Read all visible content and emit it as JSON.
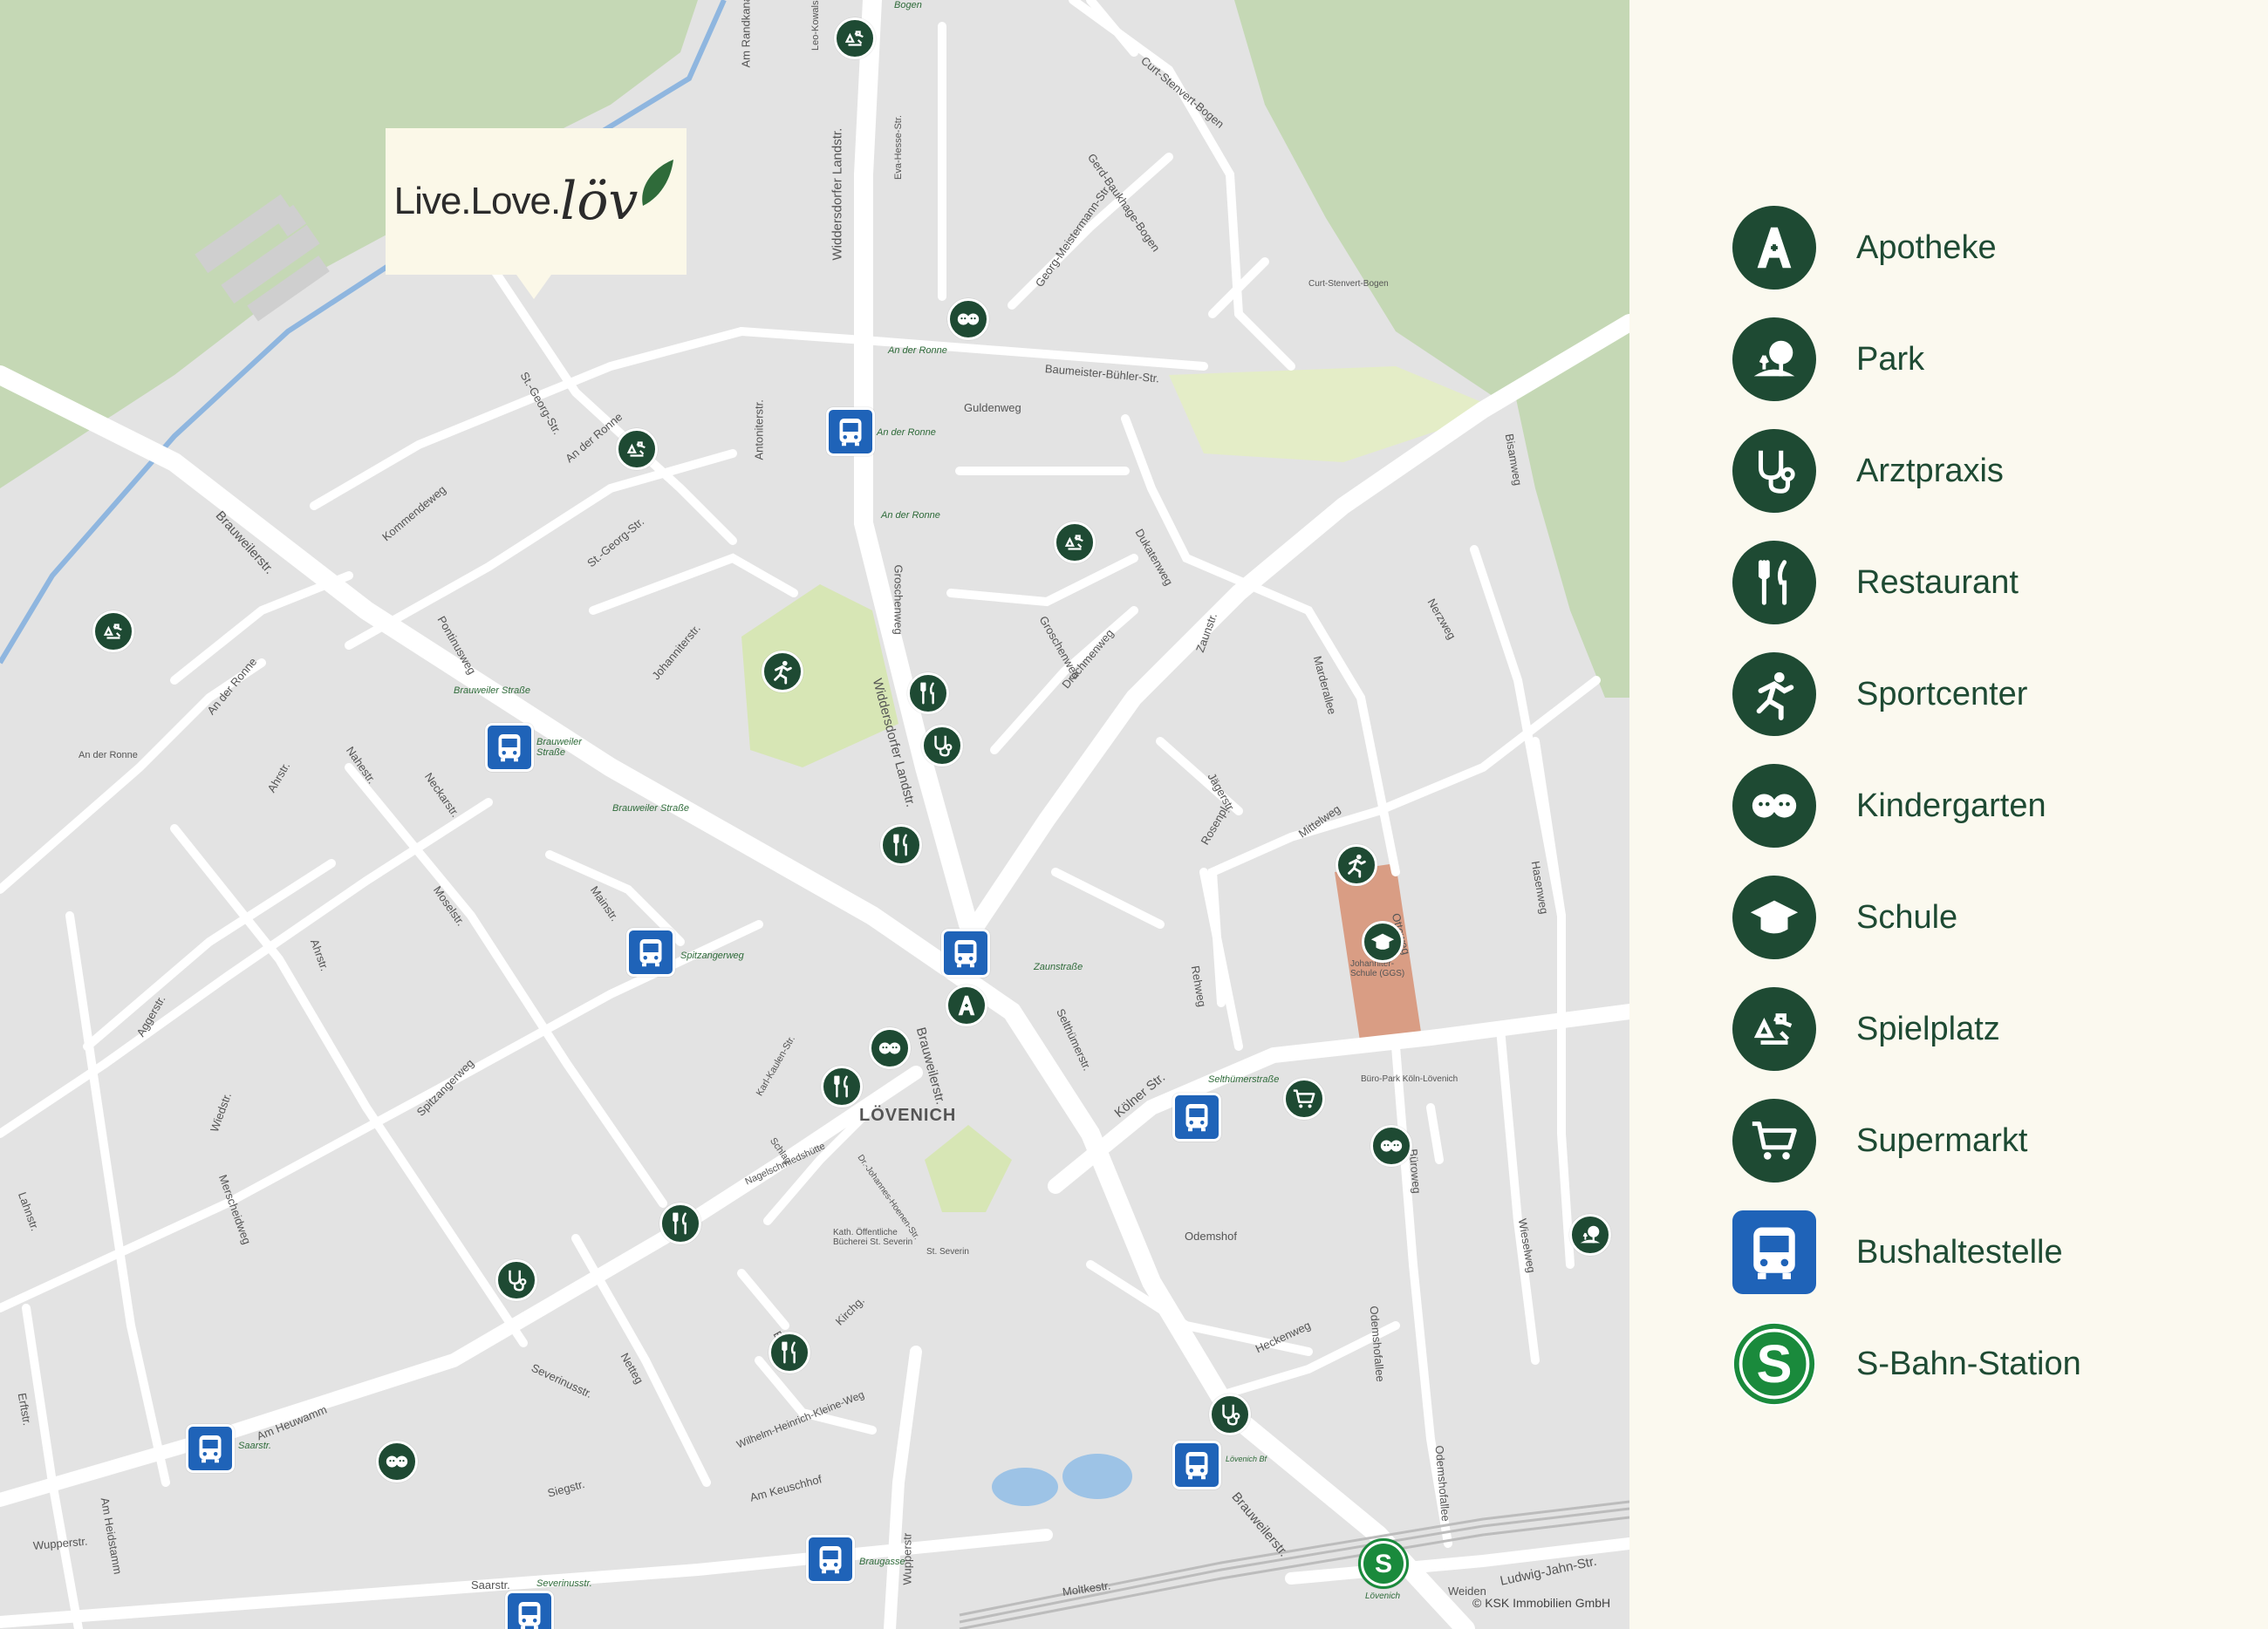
{
  "logo": {
    "text": "Live.Love.",
    "script": "löv"
  },
  "copyright": "© KSK Immobilien GmbH",
  "colors": {
    "marker": "#1e4a33",
    "bus": "#1f63b8",
    "sbahn": "#1a8a3c",
    "park": "#c5d8b5",
    "road": "#ffffff",
    "block": "#e3e3e3",
    "legend_bg": "#fbf9ef"
  },
  "legend": [
    {
      "label": "Apotheke",
      "icon": "pharmacy-icon"
    },
    {
      "label": "Park",
      "icon": "park-icon"
    },
    {
      "label": "Arztpraxis",
      "icon": "stethoscope-icon"
    },
    {
      "label": "Restaurant",
      "icon": "cutlery-icon"
    },
    {
      "label": "Sportcenter",
      "icon": "runner-icon"
    },
    {
      "label": "Kindergarten",
      "icon": "children-icon"
    },
    {
      "label": "Schule",
      "icon": "graduation-cap-icon"
    },
    {
      "label": "Spielplatz",
      "icon": "playground-icon"
    },
    {
      "label": "Supermarkt",
      "icon": "shopping-cart-icon"
    },
    {
      "label": "Bushaltestelle",
      "icon": "bus-icon"
    },
    {
      "label": "S-Bahn-Station",
      "icon": "sbahn-icon"
    }
  ],
  "streets": [
    "Am Randkanal",
    "Leo-Kowalski-Str.",
    "Bogen",
    "Curt-Stenvert-Bogen",
    "Gerd-Baukhage-Bogen",
    "Georg-Meistermann-Str.",
    "Eva-Hesse-Str.",
    "Widdersdorfer Landstr.",
    "Curt-Stenvert-Bogen",
    "Baumeister-Bühler-Str.",
    "Guldenweg",
    "Am Randkanal",
    "St.-Georg-Str.",
    "An der Ronne",
    "Kommendeweg",
    "St.-Georg-Str.",
    "Antoniterstr.",
    "Groschenweg",
    "Groschenweg",
    "Dukatenweg",
    "Drachmenweg",
    "Brauweilerstr.",
    "Pontinusweg",
    "Johanniterstr.",
    "Widdersdorfer Landstr.",
    "Zaunstr.",
    "Bisamweg",
    "Nerzweg",
    "Marderallee",
    "Jägerstr.",
    "Rosenpl.",
    "Mittelweg",
    "Hasenweg",
    "Ottoweg",
    "An der Ronne",
    "An der Ronne",
    "Ahrstr.",
    "Nahestr.",
    "Neckarstr.",
    "Moselstr.",
    "Mainstr.",
    "Ahrstr.",
    "Aggerstr.",
    "Wiedstr.",
    "Merscheidweg",
    "Spitzangerweg",
    "Brauweilerstr.",
    "Karl-Kaulen-Str.",
    "Schlag",
    "Nagelschmiedshütte",
    "Dr.-Johannes-Hoenen-Str.",
    "Kirchg.",
    "Selthümerstr.",
    "Kölner Str.",
    "Rehweg",
    "Büro-Park Köln-Lövenich",
    "Büroweg",
    "Odemshof",
    "Odemshofallee",
    "Wieselweg",
    "Heckenweg",
    "Lahnstr.",
    "Erftstr.",
    "Merscheidweg",
    "Netteg",
    "Severinusstr.",
    "Baug.",
    "Kirchg.",
    "Wilhelm-Heinrich-Kleine-Weg",
    "Am Heuwamm",
    "Siegstr.",
    "Am Keuschhof",
    "Wupperstr.",
    "Am Heidstamm",
    "Saarstr.",
    "Moltkestr.",
    "Brauweilerstr.",
    "Ludwig-Jahn-Str.",
    "Weiden",
    "Odemshofallee",
    "Rosenplatz",
    "Wupperstr"
  ],
  "places": {
    "district": "LÖVENICH",
    "school": "Johanniter-Schule (GGS)",
    "library": "Kath. Öffentliche Bücherei St. Severin",
    "church": "St. Severin"
  },
  "stops": {
    "an_der_ronne_1": "An der Ronne",
    "an_der_ronne_2": "An der Ronne",
    "an_der_ronne_3": "An der Ronne",
    "brauweiler_strasse": "Brauweiler Straße",
    "brauweiler_strasse_s1": "Brauweiler Straße",
    "brauweiler_strasse_s2": "Brauweiler Straße",
    "spitzangerweg": "Spitzangerweg",
    "zaunstrasse": "Zaunstraße",
    "selthuemerstrasse": "Selthümerstraße",
    "saarstr": "Saarstr.",
    "loevenich_bf": "Lövenich Bf",
    "braugasse": "Braugasse",
    "severinusstr": "Severinusstr.",
    "saarstr_s": "Saarstr.",
    "loevenich_s": "Lövenich"
  }
}
